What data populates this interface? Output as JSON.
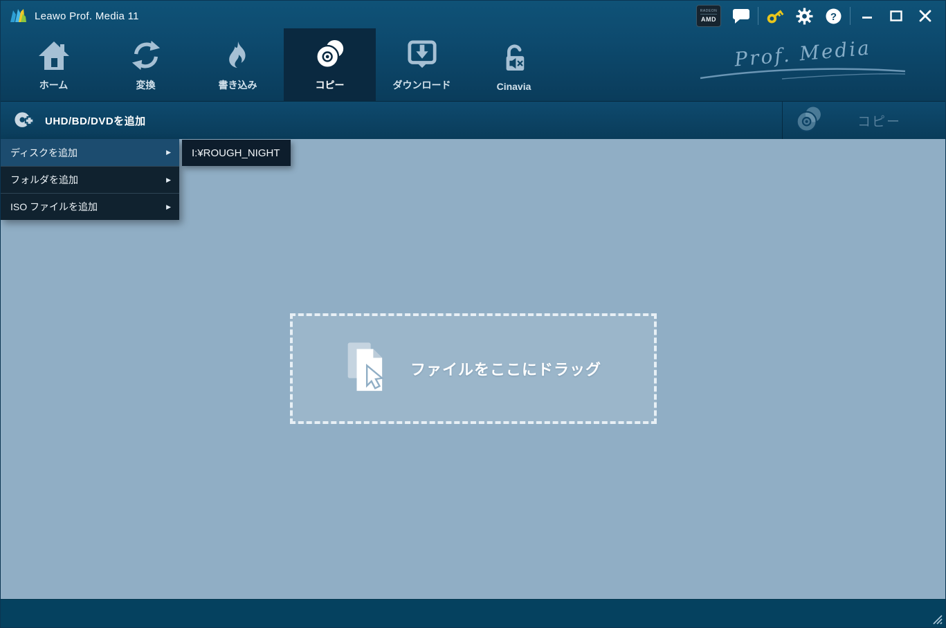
{
  "window": {
    "title": "Leawo Prof. Media 11"
  },
  "titlebar": {
    "badge_top": "RADEON",
    "badge_bottom": "AMD"
  },
  "nav": {
    "tabs": [
      {
        "label": "ホーム",
        "icon": "home-icon",
        "active": false
      },
      {
        "label": "変換",
        "icon": "convert-icon",
        "active": false
      },
      {
        "label": "書き込み",
        "icon": "burn-icon",
        "active": false
      },
      {
        "label": "コピー",
        "icon": "copy-disc-icon",
        "active": true
      },
      {
        "label": "ダウンロード",
        "icon": "download-icon",
        "active": false
      },
      {
        "label": "Cinavia",
        "icon": "cinavia-lock-icon",
        "active": false
      }
    ],
    "brand_script": "Prof. Media"
  },
  "toolbar": {
    "add_button_label": "UHD/BD/DVDを追加",
    "copy_button_label": "コピー"
  },
  "menu": {
    "items": [
      {
        "label": "ディスクを追加",
        "highlighted": true
      },
      {
        "label": "フォルダを追加",
        "highlighted": false
      },
      {
        "label": "ISO ファイルを追加",
        "highlighted": false
      }
    ]
  },
  "submenu": {
    "items": [
      {
        "label": "I:¥ROUGH_NIGHT"
      }
    ]
  },
  "dropzone": {
    "label": "ファイルをここにドラッグ"
  },
  "colors": {
    "header_top": "#0f5277",
    "header_bottom": "#0a3c5b",
    "active_tab_bg": "#0a2940",
    "toolbar_bg": "#0d4769",
    "main_bg": "#90aec5",
    "menu_item_bg": "#10222f",
    "menu_highlight_bg": "#1c4c6f",
    "submenu_bg": "#0d1d2c",
    "bottom_bar": "#05415f",
    "key_icon": "#e9c61c",
    "brand_script_color": "#94b8d2"
  }
}
